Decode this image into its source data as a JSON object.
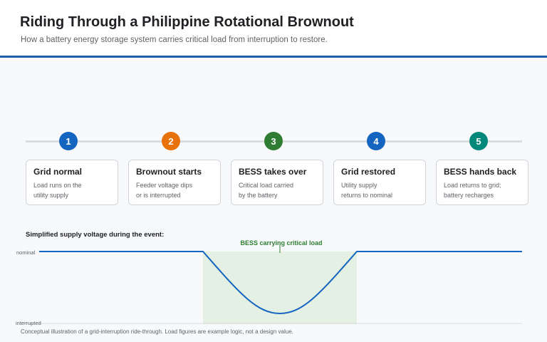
{
  "header": {
    "title": "Riding Through a Philippine Rotational Brownout",
    "subtitle": "How a battery energy storage system carries critical load from interruption to restore."
  },
  "steps": [
    {
      "number": "1",
      "color": "#1565c0",
      "title": "Grid normal",
      "desc": "Load runs on the\nutility supply"
    },
    {
      "number": "2",
      "color": "#e8710a",
      "title": "Brownout starts",
      "desc": "Feeder voltage dips\nor is interrupted"
    },
    {
      "number": "3",
      "color": "#2e7d32",
      "title": "BESS takes over",
      "desc": "Critical load carried\nby the battery"
    },
    {
      "number": "4",
      "color": "#1565c0",
      "title": "Grid restored",
      "desc": "Utility supply\nreturns to nominal"
    },
    {
      "number": "5",
      "color": "#00897b",
      "title": "BESS hands back",
      "desc": "Load returns to grid;\nbattery recharges"
    }
  ],
  "chart": {
    "heading": "Simplified supply voltage during the event:",
    "label_top": "nominal",
    "label_bottom": "interrupted",
    "annotation": "BESS carrying critical load",
    "line_color": "#1565c0",
    "band_color": "#e3f0e3",
    "annotation_color": "#2e7d32"
  },
  "footnote": "Conceptual illustration of a grid-interruption ride-through. Load figures are example logic, not a design value."
}
